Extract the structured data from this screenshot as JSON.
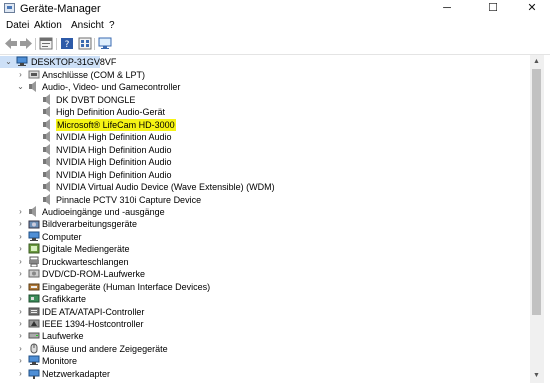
{
  "window": {
    "title": "Geräte-Manager"
  },
  "controls": {
    "minimize": "─",
    "maximize": "☐",
    "close": "✕"
  },
  "menu": [
    "Datei",
    "Aktion",
    "Ansicht",
    "?"
  ],
  "tree": {
    "root": "DESKTOP-31GV8VF",
    "items": [
      {
        "label": "Anschlüsse (COM & LPT)",
        "level": 1,
        "state": "collapsed",
        "icon": "port-icon"
      },
      {
        "label": "Audio-, Video- und Gamecontroller",
        "level": 1,
        "state": "expanded",
        "icon": "speaker-icon"
      },
      {
        "label": "DK DVBT DONGLE",
        "level": 2,
        "state": "none",
        "icon": "speaker-icon"
      },
      {
        "label": "High Definition Audio-Gerät",
        "level": 2,
        "state": "none",
        "icon": "speaker-icon"
      },
      {
        "label": "Microsoft® LifeCam HD-3000",
        "level": 2,
        "state": "none",
        "icon": "speaker-icon",
        "highlight": true
      },
      {
        "label": "NVIDIA High Definition Audio",
        "level": 2,
        "state": "none",
        "icon": "speaker-icon"
      },
      {
        "label": "NVIDIA High Definition Audio",
        "level": 2,
        "state": "none",
        "icon": "speaker-icon"
      },
      {
        "label": "NVIDIA High Definition Audio",
        "level": 2,
        "state": "none",
        "icon": "speaker-icon"
      },
      {
        "label": "NVIDIA High Definition Audio",
        "level": 2,
        "state": "none",
        "icon": "speaker-icon"
      },
      {
        "label": "NVIDIA Virtual Audio Device (Wave Extensible) (WDM)",
        "level": 2,
        "state": "none",
        "icon": "speaker-icon"
      },
      {
        "label": "Pinnacle PCTV 310i Capture Device",
        "level": 2,
        "state": "none",
        "icon": "speaker-icon"
      },
      {
        "label": "Audioeingänge und -ausgänge",
        "level": 1,
        "state": "collapsed",
        "icon": "speaker-icon"
      },
      {
        "label": "Bildverarbeitungsgeräte",
        "level": 1,
        "state": "collapsed",
        "icon": "camera-icon"
      },
      {
        "label": "Computer",
        "level": 1,
        "state": "collapsed",
        "icon": "monitor-icon"
      },
      {
        "label": "Digitale Mediengeräte",
        "level": 1,
        "state": "collapsed",
        "icon": "media-icon"
      },
      {
        "label": "Druckwarteschlangen",
        "level": 1,
        "state": "collapsed",
        "icon": "printer-icon"
      },
      {
        "label": "DVD/CD-ROM-Laufwerke",
        "level": 1,
        "state": "collapsed",
        "icon": "disc-icon"
      },
      {
        "label": "Eingabegeräte (Human Interface Devices)",
        "level": 1,
        "state": "collapsed",
        "icon": "hid-icon"
      },
      {
        "label": "Grafikkarte",
        "level": 1,
        "state": "collapsed",
        "icon": "gpu-icon"
      },
      {
        "label": "IDE ATA/ATAPI-Controller",
        "level": 1,
        "state": "collapsed",
        "icon": "controller-icon"
      },
      {
        "label": "IEEE 1394-Hostcontroller",
        "level": 1,
        "state": "collapsed",
        "icon": "firewire-icon"
      },
      {
        "label": "Laufwerke",
        "level": 1,
        "state": "collapsed",
        "icon": "drive-icon"
      },
      {
        "label": "Mäuse und andere Zeigegeräte",
        "level": 1,
        "state": "collapsed",
        "icon": "mouse-icon"
      },
      {
        "label": "Monitore",
        "level": 1,
        "state": "collapsed",
        "icon": "monitor-icon"
      },
      {
        "label": "Netzwerkadapter",
        "level": 1,
        "state": "collapsed",
        "icon": "network-icon"
      }
    ]
  }
}
